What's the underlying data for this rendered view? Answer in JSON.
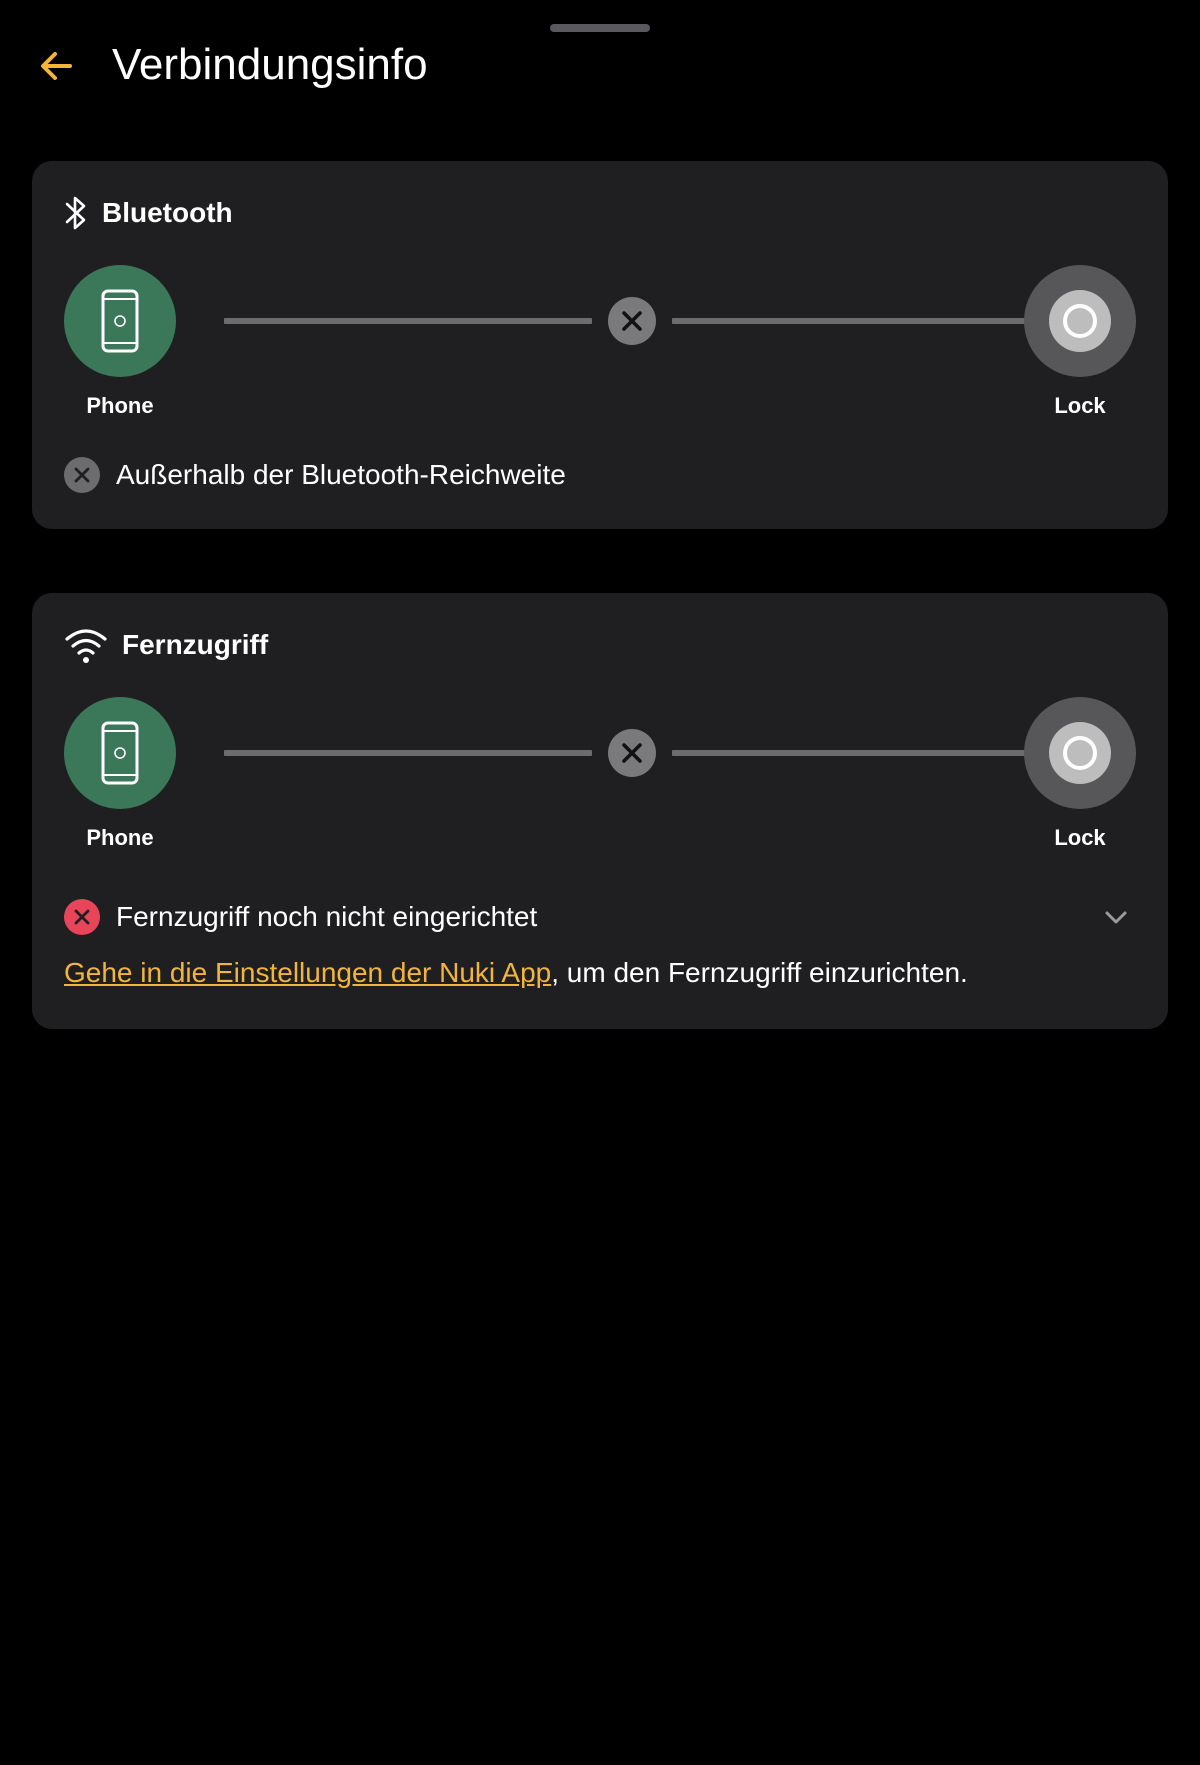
{
  "header": {
    "title": "Verbindungsinfo"
  },
  "colors": {
    "accent": "#f2b53a",
    "background": "#000000",
    "card": "#1f1f21",
    "phone_node": "#3b7759",
    "lock_node": "#575759",
    "error_red": "#e8455a",
    "neutral_grey": "#6c6c6e"
  },
  "bluetooth": {
    "title": "Bluetooth",
    "icon": "bluetooth-icon",
    "phone_label": "Phone",
    "lock_label": "Lock",
    "status_icon": "close-icon",
    "status_text": "Außerhalb der Bluetooth-Reichweite"
  },
  "remote": {
    "title": "Fernzugriff",
    "icon": "wifi-icon",
    "phone_label": "Phone",
    "lock_label": "Lock",
    "status_icon": "close-icon",
    "status_text": "Fernzugriff noch nicht eingerichtet",
    "expand_icon": "chevron-down-icon",
    "hint_link": "Gehe in die Einstellungen der Nuki App",
    "hint_rest": ", um den Fernzugriff einzurichten."
  }
}
